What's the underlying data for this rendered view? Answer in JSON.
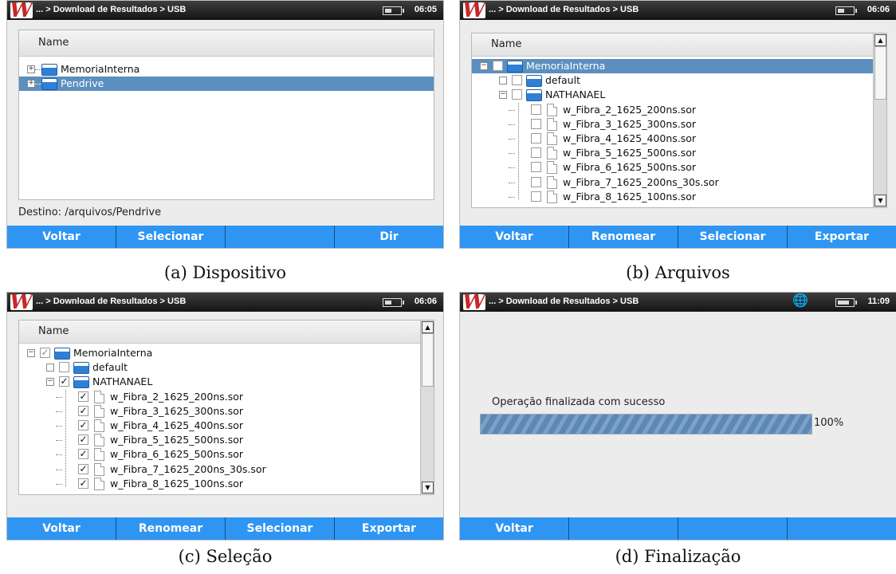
{
  "device": {
    "breadcrumb": "... > Download de Resultados > USB",
    "panels": [
      {
        "time": "06:05",
        "column_header": "Name",
        "rows": [
          "MemoriaInterna",
          "Pendrive"
        ],
        "destination": "Destino: /arquivos/Pendrive",
        "buttons": [
          "Voltar",
          "Selecionar",
          "",
          "Dir"
        ],
        "caption": "(a) Dispositivo"
      },
      {
        "time": "06:06",
        "column_header": "Name",
        "rows": [
          "MemoriaInterna",
          "default",
          "NATHANAEL",
          "w_Fibra_2_1625_200ns.sor",
          "w_Fibra_3_1625_300ns.sor",
          "w_Fibra_4_1625_400ns.sor",
          "w_Fibra_5_1625_500ns.sor",
          "w_Fibra_6_1625_500ns.sor",
          "w_Fibra_7_1625_200ns_30s.sor",
          "w_Fibra_8_1625_100ns.sor"
        ],
        "buttons": [
          "Voltar",
          "Renomear",
          "Selecionar",
          "Exportar"
        ],
        "caption": "(b) Arquivos"
      },
      {
        "time": "06:06",
        "column_header": "Name",
        "rows": [
          "MemoriaInterna",
          "default",
          "NATHANAEL",
          "w_Fibra_2_1625_200ns.sor",
          "w_Fibra_3_1625_300ns.sor",
          "w_Fibra_4_1625_400ns.sor",
          "w_Fibra_5_1625_500ns.sor",
          "w_Fibra_6_1625_500ns.sor",
          "w_Fibra_7_1625_200ns_30s.sor",
          "w_Fibra_8_1625_100ns.sor"
        ],
        "buttons": [
          "Voltar",
          "Renomear",
          "Selecionar",
          "Exportar"
        ],
        "caption": "(c) Seleção"
      },
      {
        "time": "11:09",
        "status_message": "Operação finalizada com sucesso",
        "progress_value": 100,
        "progress_label": "100%",
        "buttons": [
          "Voltar",
          "",
          "",
          ""
        ],
        "caption": "(d) Finalização"
      }
    ]
  },
  "colors": {
    "selection": "#5b8fbf",
    "softkey_bar": "#2f95f2",
    "title_bar": "#1e1e1e",
    "brand": "#c62828"
  },
  "icons": [
    "app-logo-icon",
    "battery-icon",
    "globe-icon",
    "folder-icon",
    "file-icon",
    "checkbox-icon",
    "expander-icon"
  ]
}
